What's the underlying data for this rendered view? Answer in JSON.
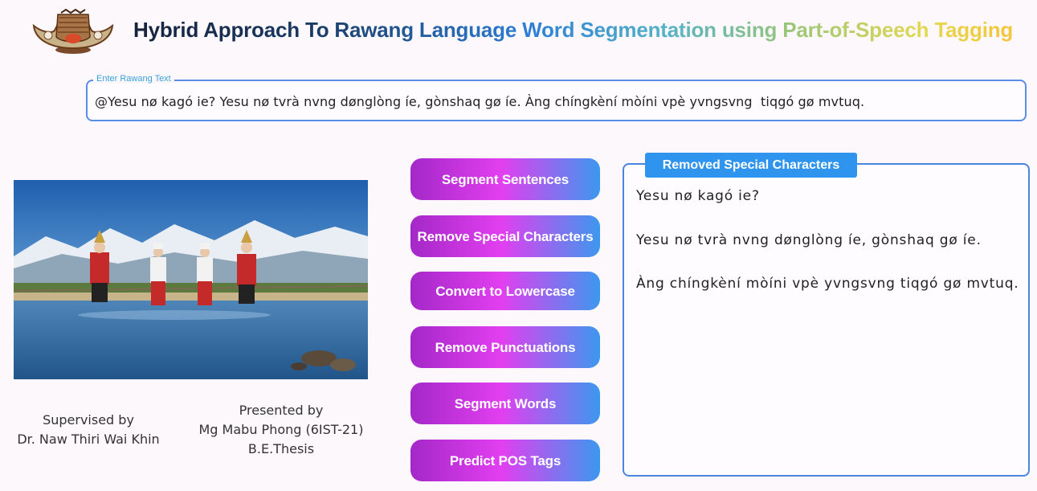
{
  "header": {
    "title": "Hybrid Approach To Rawang Language Word Segmentation using Part-of-Speech Tagging",
    "logo_icon": "hornbill-headdress-logo-icon"
  },
  "input": {
    "label": "Enter Rawang Text",
    "value": "@Yesu nø kagó ie? Yesu nø tvrà nvng dønglòng íe, gònshaq gø íe. Àng chíngkèní mòíni vpè yvngsvng  tiqgó gø mvtuq."
  },
  "image": {
    "subject": "photo-rawang-dancers-river"
  },
  "credits": {
    "supervised_label": "Supervised by",
    "supervisor": "Dr. Naw Thiri Wai Khin",
    "presented_label": "Presented by",
    "presenter": "Mg Mabu Phong (6IST-21)",
    "degree": "B.E.Thesis"
  },
  "buttons": {
    "segment_sentences": "Segment Sentences",
    "remove_special": "Remove Special Characters",
    "lowercase": "Convert to Lowercase",
    "remove_punct": "Remove Punctuations",
    "segment_words": "Segment Words",
    "predict_pos": "Predict POS Tags"
  },
  "output": {
    "tab_label": "Removed Special Characters",
    "lines": [
      "Yesu nø kagó ie?",
      "Yesu nø tvrà nvng dønglòng íe, gònshaq gø íe.",
      "Àng chíngkèní mòíni vpè yvngsvng tiqgó gø mvtuq."
    ]
  },
  "colors": {
    "accent_blue": "#2f94ee",
    "button_start": "#a428c8",
    "button_mid": "#e23ff0",
    "button_end": "#3c98ee",
    "input_border": "#5b8de6"
  }
}
